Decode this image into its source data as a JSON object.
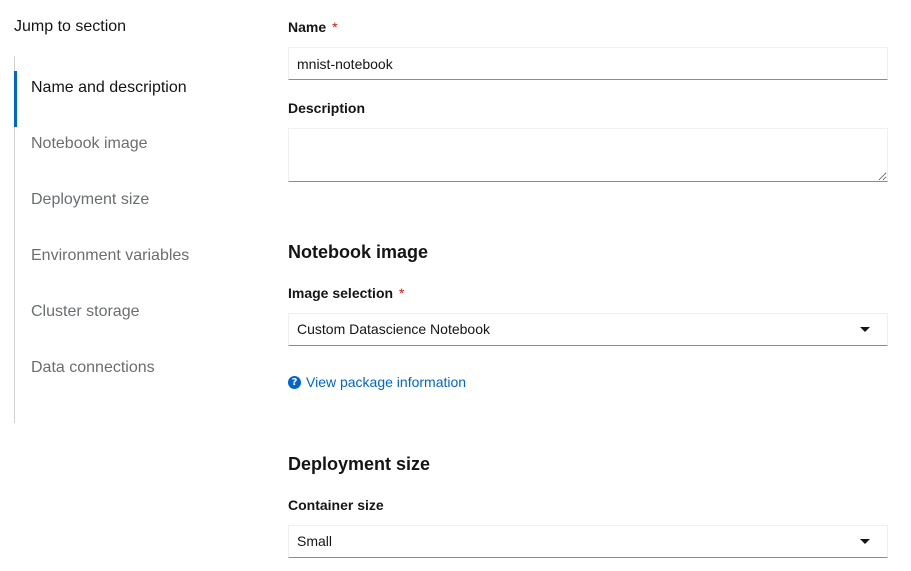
{
  "nav": {
    "title": "Jump to section",
    "items": [
      {
        "label": "Name and description",
        "active": true
      },
      {
        "label": "Notebook image",
        "active": false
      },
      {
        "label": "Deployment size",
        "active": false
      },
      {
        "label": "Environment variables",
        "active": false
      },
      {
        "label": "Cluster storage",
        "active": false
      },
      {
        "label": "Data connections",
        "active": false
      }
    ]
  },
  "name_section": {
    "name_label": "Name",
    "required_mark": "*",
    "name_value": "mnist-notebook",
    "description_label": "Description",
    "description_value": ""
  },
  "notebook_image": {
    "title": "Notebook image",
    "selection_label": "Image selection",
    "required_mark": "*",
    "selected_value": "Custom Datascience Notebook",
    "link_label": "View package information"
  },
  "deployment_size": {
    "title": "Deployment size",
    "container_label": "Container size",
    "selected_value": "Small"
  },
  "colors": {
    "accent": "#0066cc",
    "required": "#c9190b"
  }
}
